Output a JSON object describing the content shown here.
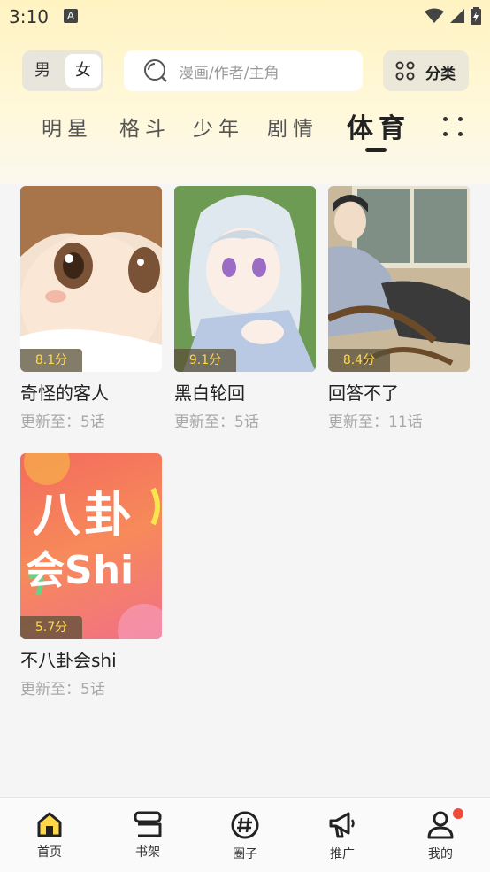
{
  "status_bar": {
    "time": "3:10",
    "notif_icon_letter": "A"
  },
  "header": {
    "gender": {
      "male": "男",
      "female": "女",
      "selected": "女"
    },
    "search": {
      "placeholder": "漫画/作者/主角"
    },
    "category_button": {
      "label": "分类"
    }
  },
  "tabs": {
    "items": [
      "明星",
      "格斗",
      "少年",
      "剧情",
      "体育"
    ],
    "active": "体育"
  },
  "comics": [
    {
      "title": "奇怪的客人",
      "score": "8.1分",
      "update": "更新至：5话"
    },
    {
      "title": "黑白轮回",
      "score": "9.1分",
      "update": "更新至：5话"
    },
    {
      "title": "回答不了",
      "score": "8.4分",
      "update": "更新至：11话"
    },
    {
      "title": "不八卦会shi",
      "score": "5.7分",
      "update": "更新至：5话",
      "cover_text_line1": "八卦",
      "cover_text_line2": "会Shi"
    }
  ],
  "bottom_nav": {
    "items": [
      {
        "label": "首页",
        "icon": "home-icon",
        "active": true
      },
      {
        "label": "书架",
        "icon": "bookshelf-icon"
      },
      {
        "label": "圈子",
        "icon": "hashtag-icon"
      },
      {
        "label": "推广",
        "icon": "megaphone-icon"
      },
      {
        "label": "我的",
        "icon": "profile-icon",
        "has_badge": true
      }
    ]
  },
  "colors": {
    "accent": "#ffd84a",
    "badge": "#f04a3a",
    "header_bg": "#fff3c2"
  }
}
